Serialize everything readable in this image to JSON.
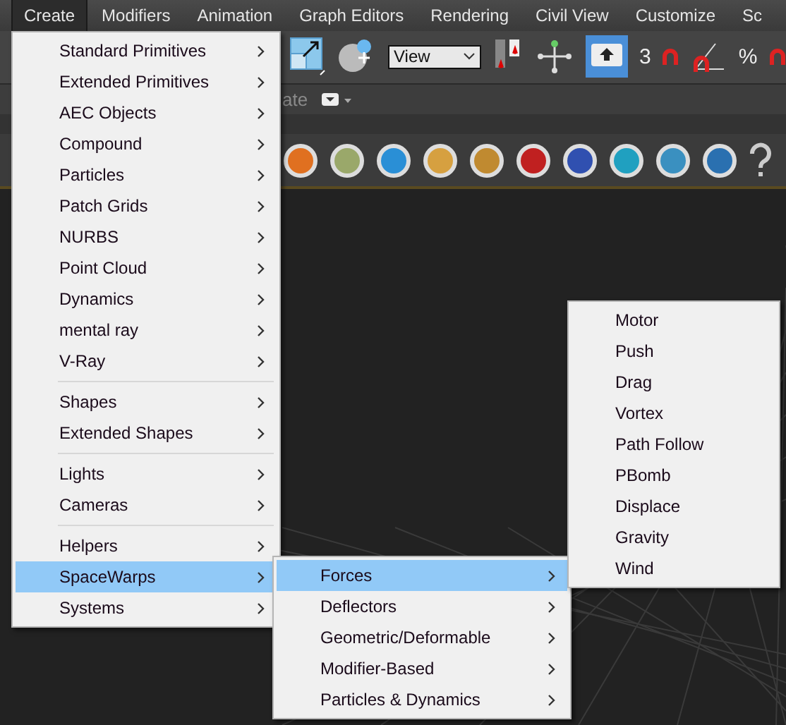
{
  "menubar": {
    "items": [
      {
        "label": "Create",
        "selected": true
      },
      {
        "label": "Modifiers",
        "selected": false
      },
      {
        "label": "Animation",
        "selected": false
      },
      {
        "label": "Graph Editors",
        "selected": false
      },
      {
        "label": "Rendering",
        "selected": false
      },
      {
        "label": "Civil View",
        "selected": false
      },
      {
        "label": "Customize",
        "selected": false
      },
      {
        "label": "Sc",
        "selected": false
      }
    ]
  },
  "toolbar": {
    "view_dropdown": {
      "value": "View"
    },
    "snap_labels": [
      "3",
      "%"
    ],
    "ribbon_text": "ate"
  },
  "create_menu": {
    "groups": [
      {
        "items": [
          {
            "label": "Standard Primitives",
            "selected": false,
            "has_submenu": true
          },
          {
            "label": "Extended Primitives",
            "selected": false,
            "has_submenu": true
          },
          {
            "label": "AEC Objects",
            "selected": false,
            "has_submenu": true
          },
          {
            "label": "Compound",
            "selected": false,
            "has_submenu": true
          },
          {
            "label": "Particles",
            "selected": false,
            "has_submenu": true
          },
          {
            "label": "Patch Grids",
            "selected": false,
            "has_submenu": true
          },
          {
            "label": "NURBS",
            "selected": false,
            "has_submenu": true
          },
          {
            "label": "Point Cloud",
            "selected": false,
            "has_submenu": true
          },
          {
            "label": "Dynamics",
            "selected": false,
            "has_submenu": true
          },
          {
            "label": "mental ray",
            "selected": false,
            "has_submenu": true
          },
          {
            "label": "V-Ray",
            "selected": false,
            "has_submenu": true
          }
        ]
      },
      {
        "items": [
          {
            "label": "Shapes",
            "selected": false,
            "has_submenu": true
          },
          {
            "label": "Extended Shapes",
            "selected": false,
            "has_submenu": true
          }
        ]
      },
      {
        "items": [
          {
            "label": "Lights",
            "selected": false,
            "has_submenu": true
          },
          {
            "label": "Cameras",
            "selected": false,
            "has_submenu": true
          }
        ]
      },
      {
        "items": [
          {
            "label": "Helpers",
            "selected": false,
            "has_submenu": true
          },
          {
            "label": "SpaceWarps",
            "selected": true,
            "has_submenu": true
          },
          {
            "label": "Systems",
            "selected": false,
            "has_submenu": true
          }
        ]
      }
    ]
  },
  "spacewarps_menu": {
    "items": [
      {
        "label": "Forces",
        "selected": true,
        "has_submenu": true
      },
      {
        "label": "Deflectors",
        "selected": false,
        "has_submenu": true
      },
      {
        "label": "Geometric/Deformable",
        "selected": false,
        "has_submenu": true
      },
      {
        "label": "Modifier-Based",
        "selected": false,
        "has_submenu": true
      },
      {
        "label": "Particles & Dynamics",
        "selected": false,
        "has_submenu": true
      }
    ]
  },
  "forces_menu": {
    "items": [
      {
        "label": "Motor",
        "selected": false,
        "has_submenu": false
      },
      {
        "label": "Push",
        "selected": false,
        "has_submenu": false
      },
      {
        "label": "Drag",
        "selected": false,
        "has_submenu": false
      },
      {
        "label": "Vortex",
        "selected": false,
        "has_submenu": false
      },
      {
        "label": "Path Follow",
        "selected": false,
        "has_submenu": false
      },
      {
        "label": "PBomb",
        "selected": false,
        "has_submenu": false
      },
      {
        "label": "Displace",
        "selected": false,
        "has_submenu": false
      },
      {
        "label": "Gravity",
        "selected": false,
        "has_submenu": false
      },
      {
        "label": "Wind",
        "selected": false,
        "has_submenu": false
      }
    ]
  }
}
